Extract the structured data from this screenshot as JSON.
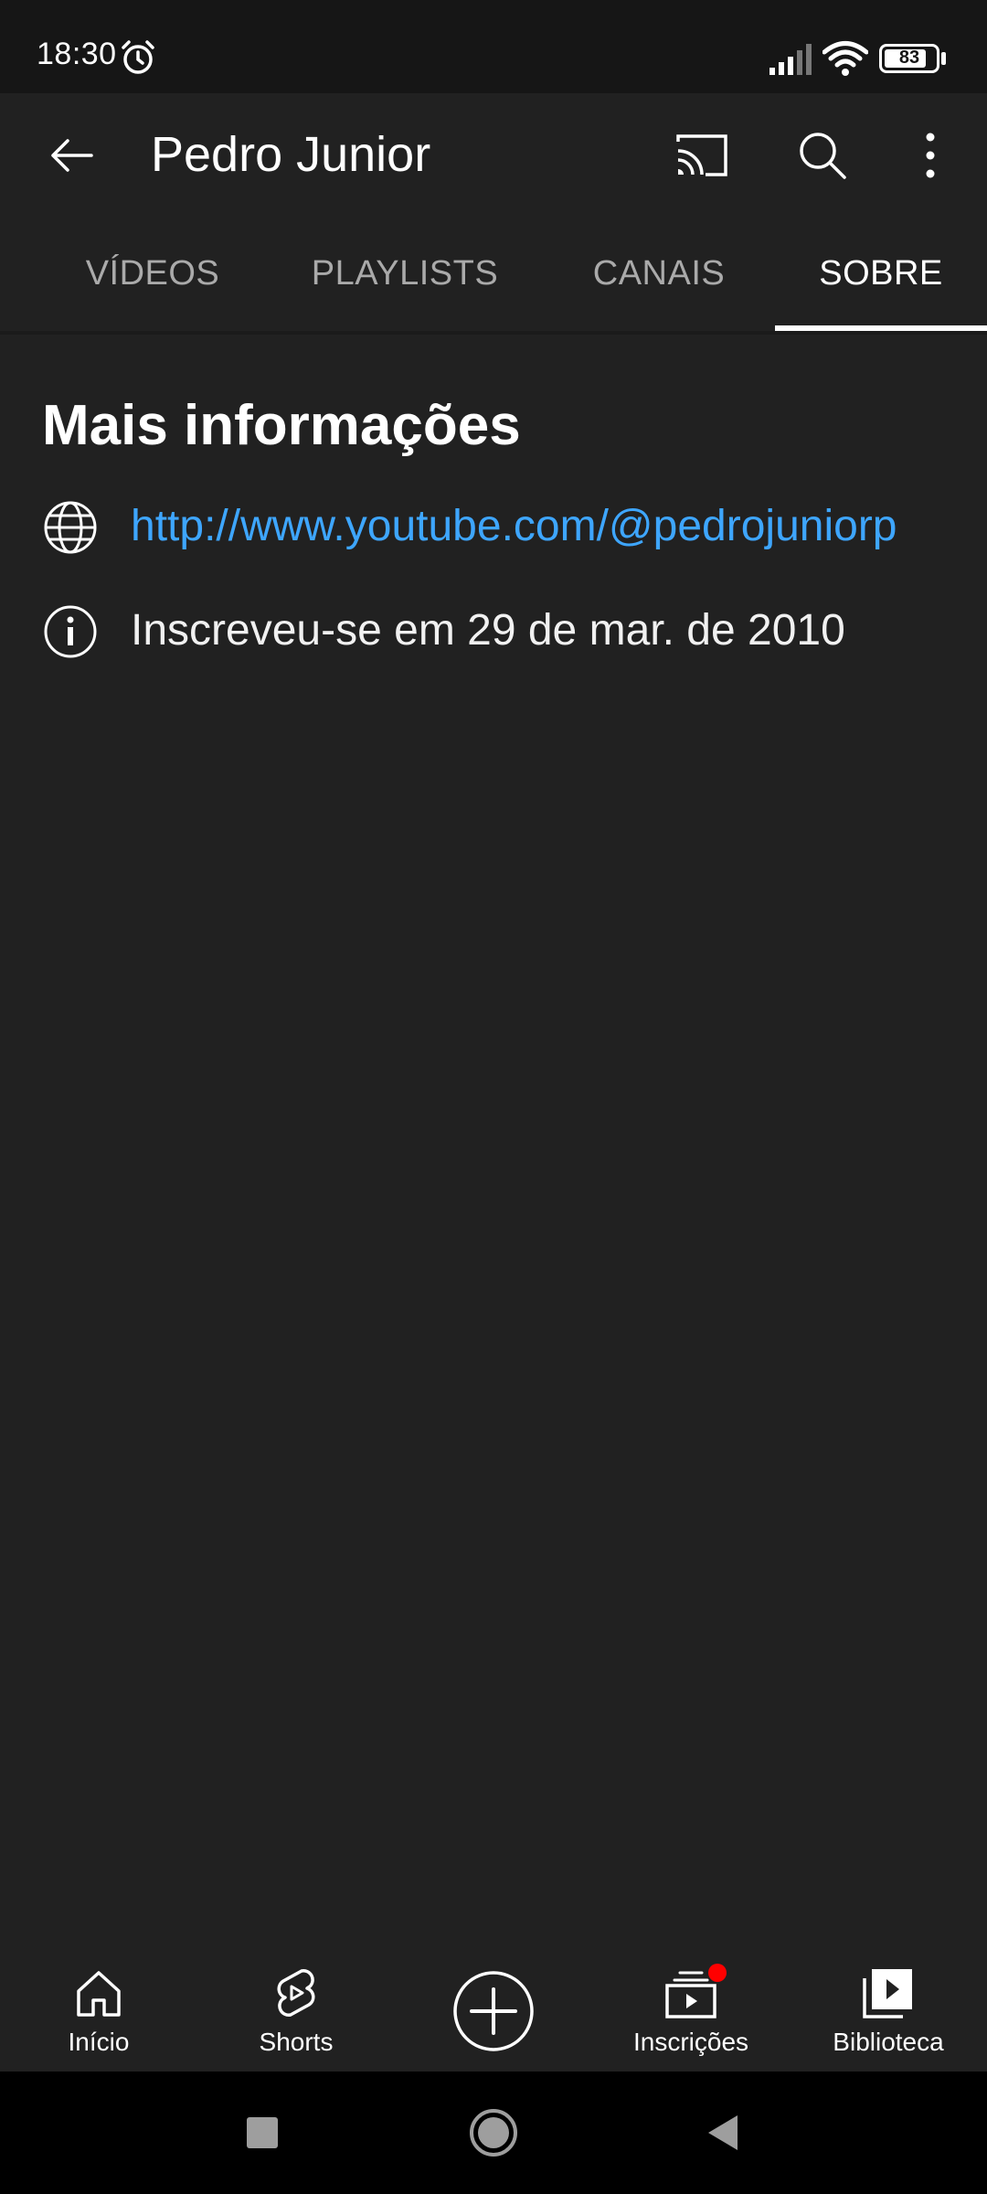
{
  "status_bar": {
    "time": "18:30",
    "battery_level": "83",
    "battery_fraction": 0.83,
    "icons": [
      "alarm-icon",
      "signal-icon",
      "wifi-icon",
      "battery-icon"
    ]
  },
  "app_bar": {
    "title": "Pedro Junior",
    "icons": [
      "back-arrow-icon",
      "cast-icon",
      "search-icon",
      "more-vert-icon"
    ]
  },
  "tabs": [
    {
      "label": "VÍDEOS",
      "active": false
    },
    {
      "label": "PLAYLISTS",
      "active": false
    },
    {
      "label": "CANAIS",
      "active": false
    },
    {
      "label": "SOBRE",
      "active": true
    }
  ],
  "about": {
    "heading": "Mais informações",
    "link": {
      "icon": "globe-icon",
      "text": "http://www.youtube.com/@pedrojuniorp"
    },
    "joined": {
      "icon": "info-icon",
      "text": "Inscreveu-se em 29 de mar. de 2010"
    }
  },
  "bottom_nav": {
    "items": [
      {
        "label": "Início",
        "icon": "home-icon"
      },
      {
        "label": "Shorts",
        "icon": "shorts-icon"
      },
      {
        "label": "",
        "icon": "create-icon"
      },
      {
        "label": "Inscrições",
        "icon": "subscriptions-icon",
        "has_notification": true
      },
      {
        "label": "Biblioteca",
        "icon": "library-icon"
      }
    ]
  },
  "colors": {
    "background": "#212121",
    "status_bar": "#161616",
    "link": "#3ea6ff",
    "inactive_tab": "#aaaaaa",
    "notification": "#ff0000",
    "system_nav": "#000000"
  }
}
